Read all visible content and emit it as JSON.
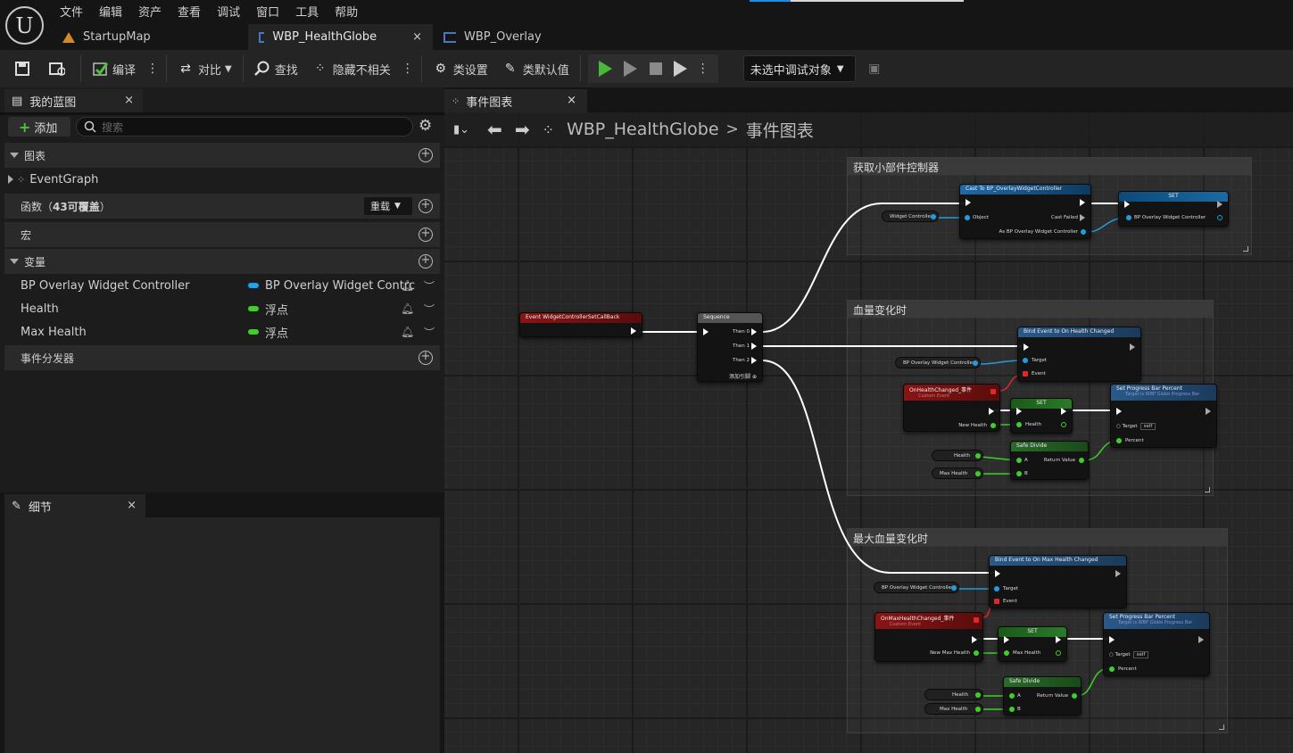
{
  "menu": [
    "文件",
    "编辑",
    "资产",
    "查看",
    "调试",
    "窗口",
    "工具",
    "帮助"
  ],
  "doc_tabs": [
    {
      "label": "StartupMap",
      "icon": "map-icon"
    },
    {
      "label": "WBP_HealthGlobe",
      "icon": "blueprint-icon",
      "close": "×"
    },
    {
      "label": "WBP_Overlay",
      "icon": "blueprint-icon"
    }
  ],
  "toolbar": {
    "compile": "编译",
    "diff": "对比",
    "find": "查找",
    "hide_unrelated": "隐藏不相关",
    "class_settings": "类设置",
    "class_defaults": "类默认值",
    "debug_object": "未选中调试对象"
  },
  "my_blueprint": {
    "tab": "我的蓝图",
    "close": "×",
    "add": "添加",
    "search_placeholder": "搜索",
    "graphs": "图表",
    "event_graph": "EventGraph",
    "functions": "函数（",
    "functions_count": "43可覆盖",
    "functions_end": "）",
    "override": "重载",
    "macros": "宏",
    "variables": "变量",
    "dispatchers": "事件分发器",
    "vars": [
      {
        "name": "BP Overlay Widget Controller",
        "type": "BP Overlay Widget Contrc",
        "color": "#1ea4f0"
      },
      {
        "name": "Health",
        "type": "浮点",
        "color": "#3ecf2a"
      },
      {
        "name": "Max Health",
        "type": "浮点",
        "color": "#3ecf2a"
      }
    ]
  },
  "details": {
    "tab": "细节",
    "close": "×"
  },
  "graph": {
    "tab": "事件图表",
    "close": "×",
    "breadcrumb_bp": "WBP_HealthGlobe",
    "breadcrumb_sep": ">",
    "breadcrumb_graph": "事件图表",
    "comments": [
      "获取小部件控制器",
      "血量变化时",
      "最大血量变化时"
    ],
    "event_node": "Event WidgetControllerSetCallBack",
    "sequence": {
      "title": "Sequence",
      "then0": "Then 0",
      "then1": "Then 1",
      "then2": "Then 2",
      "add_pin": "添加引脚"
    },
    "cast": {
      "title": "Cast To BP_OverlayWidgetController",
      "object": "Object",
      "cast_failed": "Cast Failed",
      "as": "As BP Overlay Widget Controller"
    },
    "widget_controller": "Widget Controller",
    "set": "SET",
    "bp_overlay_wc": "BP Overlay Widget Controller",
    "bind_health": "Bind Event to On Health Changed",
    "bind_max_health": "Bind Event to On Max Health Changed",
    "target": "Target",
    "event": "Event",
    "on_health_changed": "OnHealthChanged_事件",
    "on_max_health_changed": "OnMaxHealthChanged_事件",
    "custom_event": "Custom Event",
    "new_health": "New Health",
    "new_max_health": "New Max Health",
    "health": "Health",
    "max_health": "Max Health",
    "set_progress": "Set Progress Bar Percent",
    "set_progress_sub": "Target is WBP Globe Progress Bar",
    "self": "self",
    "percent": "Percent",
    "safe_divide": "Safe Divide",
    "a": "A",
    "b": "B",
    "return_value": "Return Value"
  }
}
